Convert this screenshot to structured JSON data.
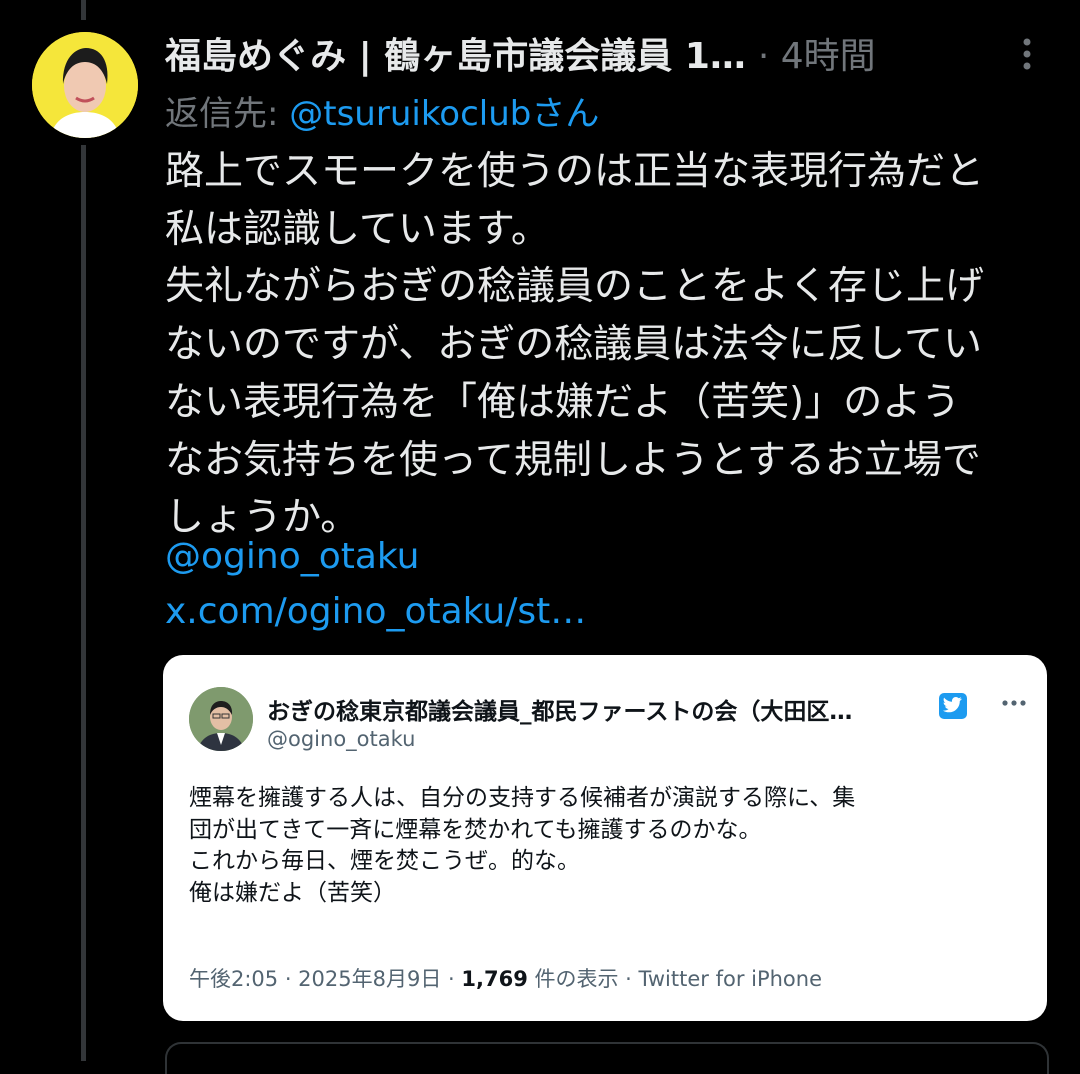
{
  "tweet": {
    "display_name": "福島めぐみ | 鶴ヶ島市議会議員 1…",
    "time": "· 4時間",
    "reply_prefix": "返信先: ",
    "reply_handle": "@tsuruikoclubさん",
    "text": "路上でスモークを使うのは正当な表現行為だと\n私は認識しています。\n失礼ながらおぎの稔議員のことをよく存じ上げ\nないのですが、おぎの稔議員は法令に反してい\nない表現行為を「俺は嫌だよ（苦笑)」のよう\nなお気持ちを使って規制しようとするお立場で\nしょうか。",
    "mention": "@ogino_otaku",
    "url": "x.com/ogino_otaku/st…"
  },
  "quoted": {
    "name": "おぎの稔東京都議会議員_都民ファーストの会（大田区…",
    "handle": "@ogino_otaku",
    "text": "煙幕を擁護する人は、自分の支持する候補者が演説する際に、集\n団が出てきて一斉に煙幕を焚かれても擁護するのかな。\nこれから毎日、煙を焚こうぜ。的な。\n俺は嫌だよ（苦笑）",
    "meta_time": "午後2:05 · 2025年8月9日 · ",
    "meta_views": "1,769",
    "meta_views_suffix": " 件の表示 · Twitter for iPhone"
  },
  "icons": {
    "more": "more-vertical-icon",
    "card_more": "more-horizontal-icon",
    "badge": "twitter-bird-badge-icon"
  },
  "colors": {
    "background": "#000000",
    "text": "#e7e9ea",
    "muted": "#71767b",
    "link": "#1d9bf0",
    "avatar_bg": "#f5e63a"
  }
}
